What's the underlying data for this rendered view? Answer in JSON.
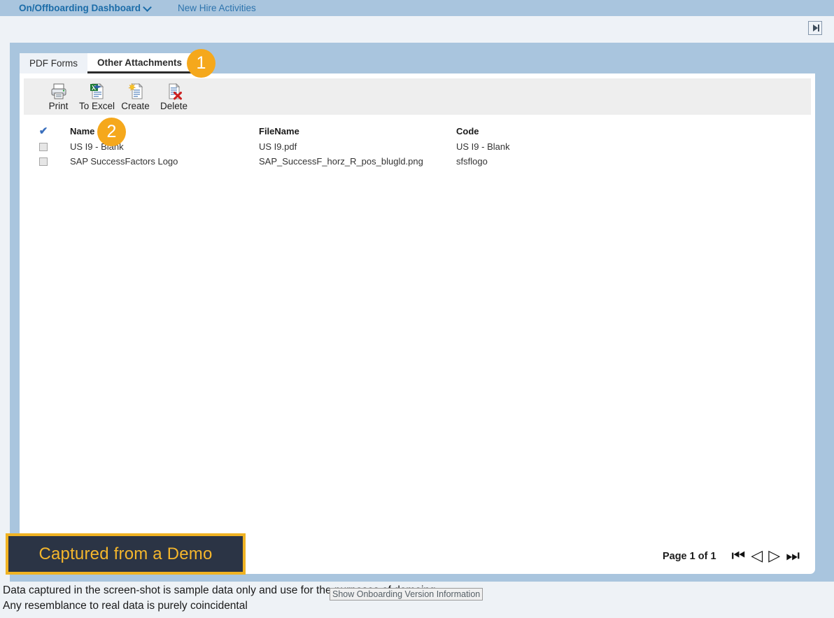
{
  "topnav": {
    "primary_label": "On/Offboarding Dashboard",
    "primary_icon": "chevron-down-icon",
    "secondary_label": "New Hire Activities"
  },
  "subbar": {
    "expand_button_icon": "expand-panel-icon"
  },
  "tabs": [
    {
      "label": "PDF Forms",
      "active": false
    },
    {
      "label": "Other Attachments",
      "active": true
    }
  ],
  "toolbar": {
    "buttons": [
      {
        "label": "Print",
        "icon": "printer-icon"
      },
      {
        "label": "To Excel",
        "icon": "excel-export-icon"
      },
      {
        "label": "Create",
        "icon": "create-document-icon"
      },
      {
        "label": "Delete",
        "icon": "delete-document-icon"
      }
    ]
  },
  "table": {
    "select_all_icon": "checkmark-icon",
    "columns": [
      "Name",
      "FileName",
      "Code"
    ],
    "rows": [
      {
        "selected": false,
        "name": "US I9 - Blank",
        "filename": "US I9.pdf",
        "code": "US I9 - Blank"
      },
      {
        "selected": false,
        "name": "SAP SuccessFactors Logo",
        "filename": "SAP_SuccessF_horz_R_pos_blugld.png",
        "code": "sfsflogo"
      }
    ]
  },
  "pagination": {
    "label": "Page 1 of 1",
    "first_icon": "first-page-icon",
    "prev_icon": "previous-page-icon",
    "next_icon": "next-page-icon",
    "last_icon": "last-page-icon"
  },
  "demo_badge": {
    "text": "Captured from a Demo"
  },
  "footer": {
    "line1": "Data captured in the screen-shot is sample data only and use for the purposes of demoing.",
    "line2": "Any resemblance to real data is purely coincidental"
  },
  "tooltip": {
    "text": "Show Onboarding Version Information"
  },
  "callouts": [
    {
      "number": "1"
    },
    {
      "number": "2"
    }
  ],
  "colors": {
    "nav_blue": "#a9c5de",
    "link_blue": "#1b6ca8",
    "panel_white": "#ffffff",
    "toolbar_grey": "#eeeeee",
    "callout_orange": "#f5a81c",
    "badge_navy": "#2b3445",
    "badge_gold": "#f0b323"
  }
}
